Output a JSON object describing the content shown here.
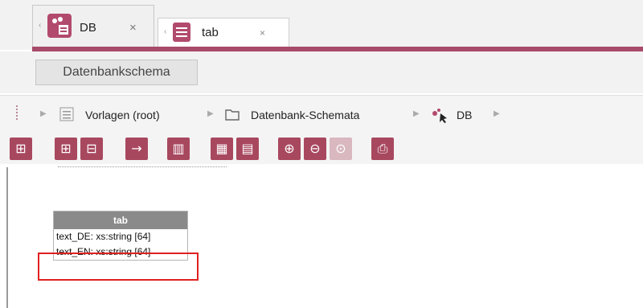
{
  "tabs": [
    {
      "label": "DB",
      "close": "×",
      "active": true,
      "icon": "database-schema-icon"
    },
    {
      "label": "tab",
      "close": "×",
      "active": false,
      "icon": "table-icon"
    }
  ],
  "subtab": {
    "label": "Datenbankschema"
  },
  "breadcrumb": [
    {
      "label": "Vorlagen (root)",
      "icon": "template-store-icon"
    },
    {
      "label": "Datenbank-Schemata",
      "icon": "folder-icon"
    },
    {
      "label": "DB",
      "icon": "database-schema-icon"
    }
  ],
  "toolbar": {
    "buttons": [
      "add-table-icon",
      "add-column-icon",
      "remove-column-icon",
      "link-arrow-icon",
      "delete-icon",
      "layout-grid-icon",
      "layout-alt-icon",
      "zoom-in-icon",
      "zoom-out-icon",
      "zoom-reset-icon",
      "print-icon"
    ]
  },
  "diagram": {
    "table": {
      "name": "tab",
      "columns": [
        "text_DE: xs:string [64]",
        "text_EN: xs:string [64]"
      ]
    }
  },
  "colors": {
    "accent": "#a8485f",
    "highlight": "#e02020",
    "tabline": "#a84a6a"
  }
}
